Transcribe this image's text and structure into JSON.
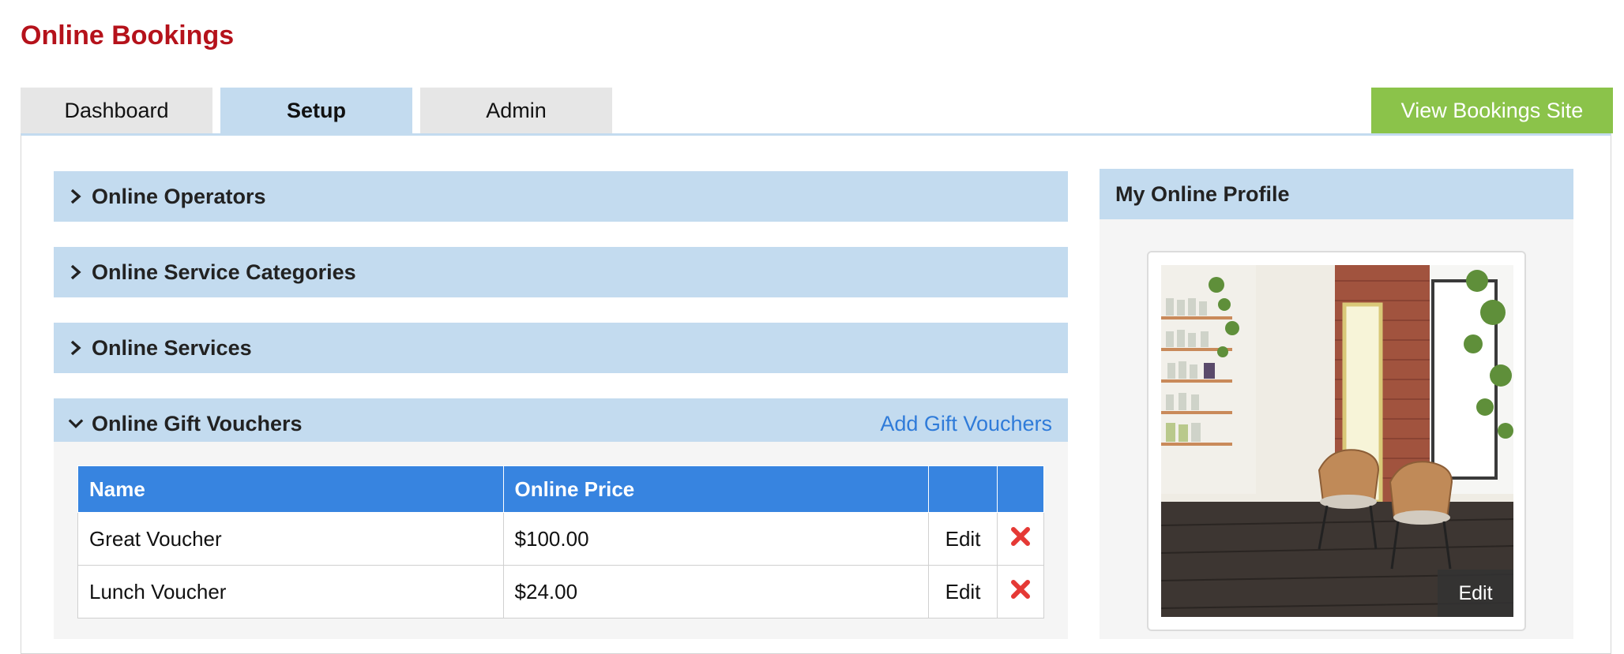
{
  "page": {
    "title": "Online Bookings"
  },
  "tabs": [
    {
      "label": "Dashboard"
    },
    {
      "label": "Setup"
    },
    {
      "label": "Admin"
    }
  ],
  "view_site_button": {
    "label": "View Bookings Site"
  },
  "sections": [
    {
      "label": "Online Operators",
      "expanded": false
    },
    {
      "label": "Online Service Categories",
      "expanded": false
    },
    {
      "label": "Online Services",
      "expanded": false
    },
    {
      "label": "Online Gift Vouchers",
      "expanded": true,
      "action_label": "Add Gift Vouchers"
    }
  ],
  "vouchers_table": {
    "headers": [
      "Name",
      "Online Price",
      "",
      ""
    ],
    "rows": [
      {
        "name": "Great Voucher",
        "price": "$100.00",
        "edit": "Edit"
      },
      {
        "name": "Lunch Voucher",
        "price": "$24.00",
        "edit": "Edit"
      }
    ]
  },
  "profile": {
    "title": "My Online Profile",
    "photo_edit_label": "Edit"
  },
  "colors": {
    "brand_red": "#b5121b",
    "accent_blue": "#3784e0",
    "section_blue": "#c3dbef",
    "link_blue": "#2f7bd9",
    "button_green": "#8bc34a",
    "delete_red": "#e53935"
  },
  "icons": {
    "collapsed": "chevron-right-icon",
    "expanded": "chevron-down-icon",
    "delete": "delete-x-icon"
  }
}
